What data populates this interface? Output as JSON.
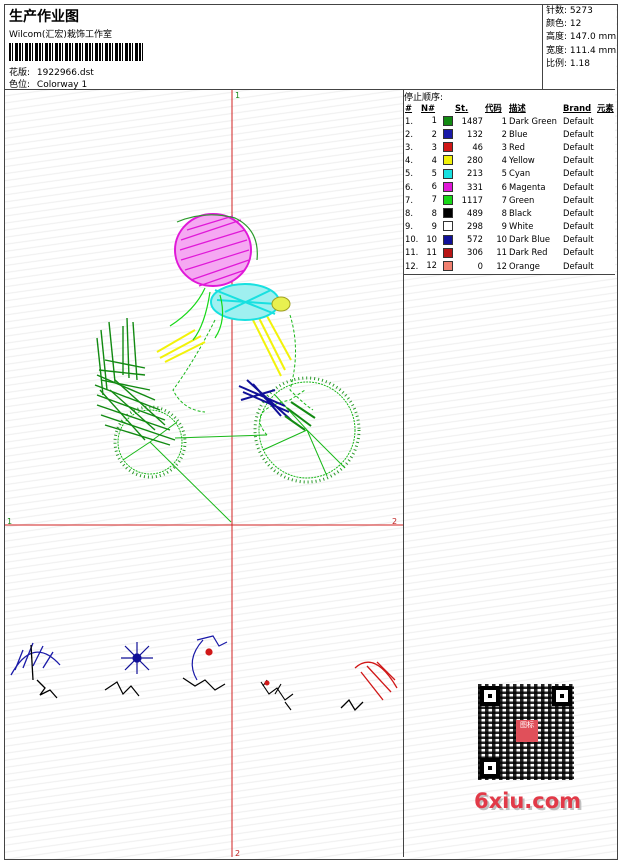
{
  "header": {
    "title": "生产作业图",
    "company": "Wilcom(汇宏)栽饰工作室",
    "design_label": "花版:",
    "design_file": "1922966.dst",
    "colorway_label": "色位:",
    "colorway": "Colorway 1"
  },
  "stats": [
    {
      "label": "针数:",
      "value": "5273"
    },
    {
      "label": "颜色:",
      "value": "12"
    },
    {
      "label": "高度:",
      "value": "147.0 mm"
    },
    {
      "label": "宽度:",
      "value": "111.4 mm"
    },
    {
      "label": "比例:",
      "value": "1.18"
    }
  ],
  "stop_sequence": {
    "title": "停止顺序:",
    "columns": [
      "#",
      "N#",
      "St.",
      "代码",
      "描述",
      "Brand",
      "元素"
    ],
    "rows": [
      {
        "n": "1.",
        "nn": "1",
        "color": "#128a12",
        "st": "1487",
        "code": "1",
        "desc": "Dark Green",
        "brand": "Default"
      },
      {
        "n": "2.",
        "nn": "2",
        "color": "#1a1aa8",
        "st": "132",
        "code": "2",
        "desc": "Blue",
        "brand": "Default"
      },
      {
        "n": "3.",
        "nn": "3",
        "color": "#d01818",
        "st": "46",
        "code": "3",
        "desc": "Red",
        "brand": "Default"
      },
      {
        "n": "4.",
        "nn": "4",
        "color": "#f2f20a",
        "st": "280",
        "code": "4",
        "desc": "Yellow",
        "brand": "Default"
      },
      {
        "n": "5.",
        "nn": "5",
        "color": "#18e0e0",
        "st": "213",
        "code": "5",
        "desc": "Cyan",
        "brand": "Default"
      },
      {
        "n": "6.",
        "nn": "6",
        "color": "#e018d8",
        "st": "331",
        "code": "6",
        "desc": "Magenta",
        "brand": "Default"
      },
      {
        "n": "7.",
        "nn": "7",
        "color": "#18d818",
        "st": "1117",
        "code": "7",
        "desc": "Green",
        "brand": "Default"
      },
      {
        "n": "8.",
        "nn": "8",
        "color": "#000000",
        "st": "489",
        "code": "8",
        "desc": "Black",
        "brand": "Default"
      },
      {
        "n": "9.",
        "nn": "9",
        "color": "#ffffff",
        "st": "298",
        "code": "9",
        "desc": "White",
        "brand": "Default"
      },
      {
        "n": "10.",
        "nn": "10",
        "color": "#101098",
        "st": "572",
        "code": "10",
        "desc": "Dark Blue",
        "brand": "Default"
      },
      {
        "n": "11.",
        "nn": "11",
        "color": "#b81414",
        "st": "306",
        "code": "11",
        "desc": "Dark Red",
        "brand": "Default"
      },
      {
        "n": "12.",
        "nn": "12",
        "color": "#f08070",
        "st": "0",
        "code": "12",
        "desc": "Orange",
        "brand": "Default"
      }
    ]
  },
  "axes": {
    "top_1": "1",
    "left_1": "1",
    "right_2": "2",
    "bottom_2": "2"
  },
  "watermark": {
    "text": "6xiu.com",
    "badge": "图标"
  }
}
